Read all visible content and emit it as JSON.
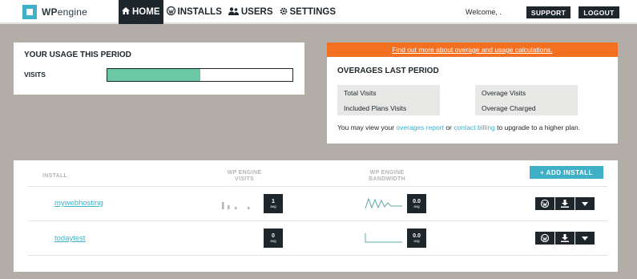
{
  "brand": {
    "logo_bold": "WP",
    "logo_light": "engine"
  },
  "nav": {
    "items": [
      {
        "label": "HOME",
        "icon": "home-icon"
      },
      {
        "label": "INSTALLS",
        "icon": "wordpress-icon"
      },
      {
        "label": "USERS",
        "icon": "users-icon"
      },
      {
        "label": "SETTINGS",
        "icon": "gear-icon"
      }
    ],
    "active": "HOME"
  },
  "header": {
    "welcome": "Welcome, .",
    "support_label": "SUPPORT",
    "logout_label": "LOGOUT"
  },
  "usage": {
    "title": "YOUR USAGE THIS PERIOD",
    "visits_label": "VISITS",
    "visits_fraction": 0.5
  },
  "overages": {
    "banner_link": "Find out more about overage and usage calculations.",
    "title": "OVERAGES LAST PERIOD",
    "cells": {
      "total_visits": "Total Visits",
      "included_plans_visits": "Included Plans Visits",
      "overage_visits": "Overage Visits",
      "overage_charged": "Overage Charged"
    },
    "note_prefix": "You may view your",
    "note_link1": "overages report",
    "note_mid": "or",
    "note_link2": "contact billing",
    "note_suffix": "to upgrade to a higher plan."
  },
  "installs": {
    "headers": {
      "install": "INSTALL",
      "visits_line1": "WP ENGINE",
      "visits_line2": "VISITS",
      "bandwidth_line1": "WP ENGINE",
      "bandwidth_line2": "BANDWIDTH"
    },
    "add_button": "+ ADD INSTALL",
    "rows": [
      {
        "name": "mywebhosting",
        "visits_value": "1",
        "visits_unit": "avg",
        "bandwidth_value": "0.0",
        "bandwidth_unit": "avg"
      },
      {
        "name": "todaytest",
        "visits_value": "0",
        "visits_unit": "avg",
        "bandwidth_value": "0.0",
        "bandwidth_unit": "avg"
      }
    ]
  },
  "colors": {
    "accent": "#3eb1c8",
    "dark": "#1d262b",
    "orange": "#f36f21",
    "usage_fill": "#6cc8a4",
    "background": "#b3ada7"
  }
}
